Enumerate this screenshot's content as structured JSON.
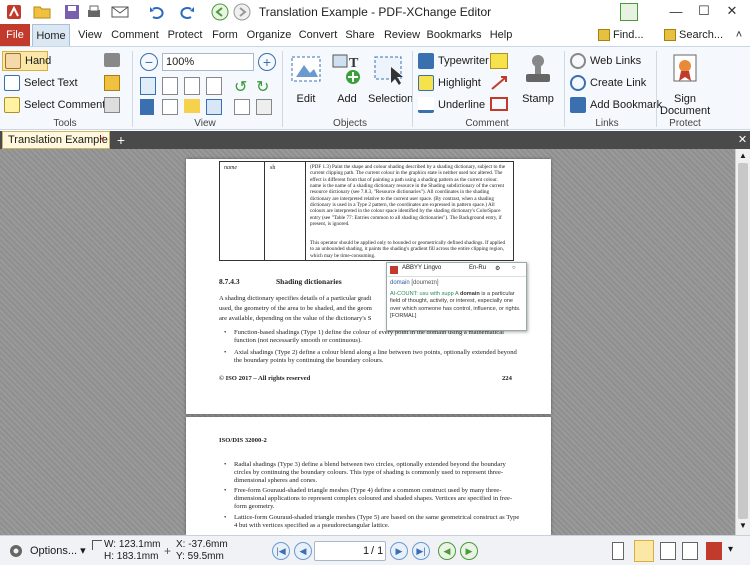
{
  "app": {
    "title": "Translation Example - PDF-XChange Editor"
  },
  "menubar": {
    "items": [
      "File",
      "Home",
      "View",
      "Comment",
      "Protect",
      "Form",
      "Organize",
      "Convert",
      "Share",
      "Review",
      "Bookmarks",
      "Help"
    ],
    "find_label": "Find...",
    "search_label": "Search..."
  },
  "ribbon": {
    "tools": {
      "hand": "Hand",
      "select_text": "Select Text",
      "select_comments": "Select Comments",
      "group": "Tools"
    },
    "view": {
      "zoom": "100%",
      "group": "View"
    },
    "objects": {
      "edit": "Edit",
      "add": "Add",
      "selection": "Selection",
      "group": "Objects"
    },
    "comment": {
      "typewriter": "Typewriter",
      "highlight": "Highlight",
      "underline": "Underline",
      "stamp": "Stamp",
      "group": "Comment"
    },
    "links": {
      "web_links": "Web Links",
      "create_link": "Create Link",
      "add_bookmark": "Add Bookmark",
      "group": "Links"
    },
    "protect": {
      "sign_document_1": "Sign",
      "sign_document_2": "Document",
      "group": "Protect"
    }
  },
  "tab": {
    "label": "Translation Example"
  },
  "page1": {
    "table_cell_1": "name",
    "table_cell_2": "sh",
    "table_desc": "(PDF 1.3) Paint the shape and colour shading described by a shading dictionary, subject to the current clipping path. The current colour in the graphics state is neither used nor altered. The effect is different from that of painting a path using a shading pattern as the current colour. name is the name of a shading dictionary resource in the Shading subdictionary of the current resource dictionary (see 7.8.3, \"Resource dictionaries\"). All coordinates in the shading dictionary are interpreted relative to the current user space. (By contrast, when a shading dictionary is used in a Type 2 pattern, the coordinates are expressed in pattern space.) All colours are interpreted in the colour space identified by the shading dictionary's ColorSpace entry (see \"Table 77: Entries common to all shading dictionaries\"). The Background entry, if present, is ignored.",
    "table_desc_2": "This operator should be applied only to bounded or geometrically defined shadings. If applied to an unbounded shading, it paints the shading's gradient fill across the entire clipping region, which may be time-consuming.",
    "section_number": "8.7.4.3",
    "section_title": "Shading dictionaries",
    "para_1": "A shading dictionary specifies details of a particular gradi",
    "para_2": "used, the geometry of the area to be shaded, and the geom",
    "para_3": "are available, depending on the value of the dictionary's S",
    "bullet_1": "Function-based shadings (Type 1) define the colour of every point in the domain using a mathematical function (not necessarily smooth or continuous).",
    "bullet_2": "Axial shadings (Type 2) define a colour blend along a line between two points, optionally extended beyond the boundary points by continuing the boundary colours.",
    "footer_left": "© ISO 2017 – All rights reserved",
    "footer_right": "224"
  },
  "lingvo": {
    "title": "ABBYY Lingvo",
    "lang": "En-Ru",
    "word": "domain",
    "transcription": "[doumeɪn]",
    "definition_prefix": "AI-COUNT: usu with supp A ",
    "definition_word": "domain",
    "definition_rest": " is a particular field of thought, activity, or interest, especially one over which someone has control, influence, or rights. [FORMAL]"
  },
  "page2": {
    "header": "ISO/DIS 32000-2",
    "bullet_1": "Radial shadings (Type 3) define a blend between two circles, optionally extended beyond the boundary circles by continuing the boundary colours. This type of shading is commonly used to represent three-dimensional spheres and cones.",
    "bullet_2": "Free-form Gouraud-shaded triangle meshes (Type 4) define a common construct used by many three-dimensional applications to represent complex coloured and shaded shapes. Vertices are specified in free-form geometry.",
    "bullet_3": "Lattice-form Gouraud-shaded triangle meshes (Type 5) are based on the same geometrical construct as Type 4 but with vertices specified as a pseudorectangular lattice."
  },
  "status": {
    "options": "Options...",
    "width": "W: 123.1mm",
    "height": "H: 183.1mm",
    "x": "X: -37.6mm",
    "y": "Y: 59.5mm",
    "page": "1",
    "page_total": "/ 1"
  },
  "colors": {
    "accent": "#c23a2b",
    "ribbon_bg": "#f5f8fc",
    "tab_active": "#fff8dc",
    "doc_bg": "#959595"
  }
}
